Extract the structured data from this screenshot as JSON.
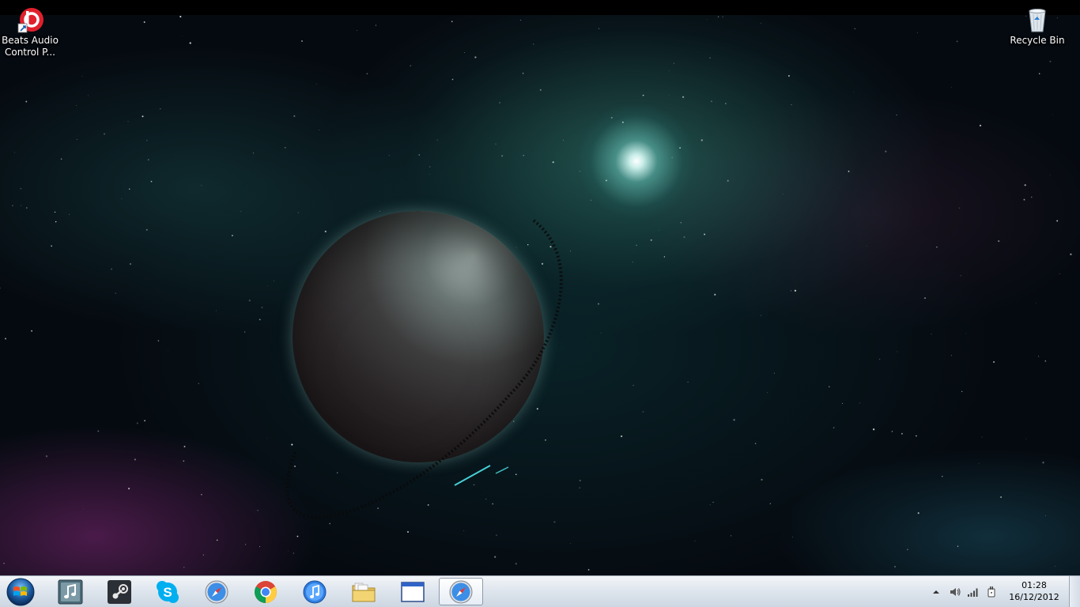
{
  "desktop": {
    "icons": [
      {
        "label": "Beats Audio\nControl P...",
        "icon": "beats-audio-icon"
      },
      {
        "label": "Recycle Bin",
        "icon": "recycle-bin-icon"
      }
    ]
  },
  "taskbar": {
    "start_icon": "windows-start-icon",
    "pinned": [
      {
        "icon": "music-note-app-icon"
      },
      {
        "icon": "steam-icon"
      },
      {
        "icon": "skype-icon"
      },
      {
        "icon": "safari-icon"
      },
      {
        "icon": "chrome-icon"
      },
      {
        "icon": "itunes-icon"
      },
      {
        "icon": "file-explorer-icon"
      },
      {
        "icon": "application-window-icon"
      },
      {
        "icon": "safari-icon",
        "active": true
      }
    ],
    "tray": {
      "icons": [
        "show-hidden-icons-arrow",
        "volume-icon",
        "network-signal-icon",
        "power-plug-icon"
      ],
      "time": "01:28",
      "date": "16/12/2012"
    }
  },
  "colors": {
    "taskbar_top": "#f3f5f8",
    "taskbar_bottom": "#cdd7e2",
    "beats_red": "#e0202c",
    "clock_text": "#000000"
  }
}
